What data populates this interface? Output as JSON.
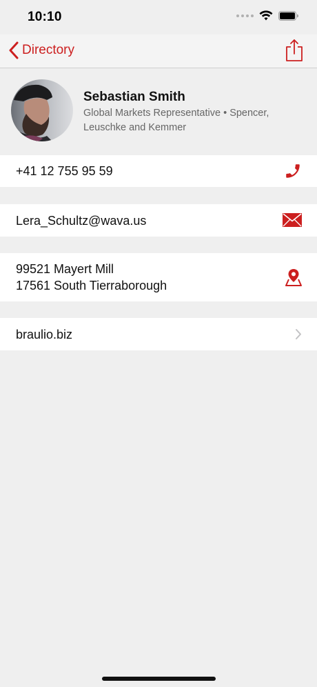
{
  "status_bar": {
    "time": "10:10"
  },
  "nav": {
    "back_label": "Directory"
  },
  "profile": {
    "name": "Sebastian Smith",
    "title": "Global Markets Representative • Spencer, Leuschke and Kemmer"
  },
  "contact": {
    "phone": "+41 12 755 95 59",
    "email": "Lera_Schultz@wava.us",
    "address_line1": "99521 Mayert Mill",
    "address_line2": "17561 South Tierraborough",
    "website": "braulio.biz"
  },
  "colors": {
    "accent": "#cc1f1f",
    "background": "#efefef",
    "row_background": "#ffffff"
  },
  "icons": {
    "back": "chevron-left-icon",
    "share": "share-icon",
    "phone": "phone-icon",
    "email": "envelope-icon",
    "address": "map-pin-icon",
    "website": "chevron-right-icon"
  }
}
